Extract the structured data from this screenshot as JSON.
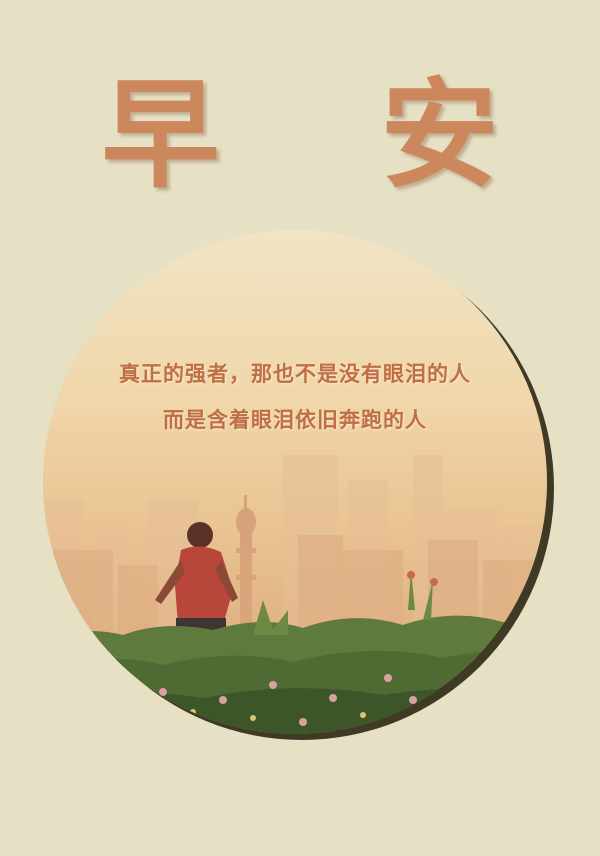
{
  "title": "早 安",
  "quote": {
    "line1": "真正的强者，那也不是没有眼泪的人",
    "line2": "而是含着眼泪依旧奔跑的人"
  },
  "colors": {
    "background": "#e6e0c4",
    "title": "#cc875c",
    "quote_text": "#c06f42",
    "shadow": "#3e3a26"
  },
  "photo": {
    "scene": "boy running toward hazy city skyline with minaret at sunrise, flowering bushes in foreground"
  }
}
